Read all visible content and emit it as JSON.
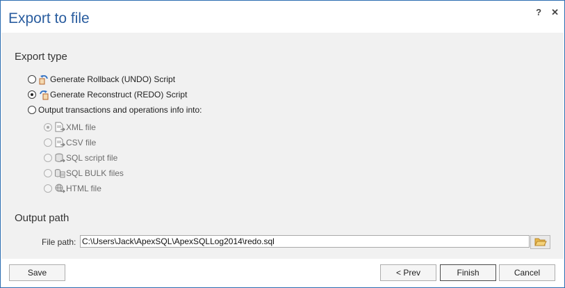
{
  "dialog": {
    "title": "Export to file",
    "help_glyph": "?",
    "close_glyph": "✕"
  },
  "export_type": {
    "heading": "Export type",
    "options": [
      {
        "label": "Generate Rollback (UNDO) Script",
        "icon": "undo-script-icon",
        "checked": false
      },
      {
        "label": "Generate Reconstruct (REDO) Script",
        "icon": "redo-script-icon",
        "checked": true
      },
      {
        "label": "Output transactions and operations info into:",
        "icon": null,
        "checked": false
      }
    ],
    "sub_options": [
      {
        "label": "XML file",
        "icon": "xml-file-icon",
        "checked": true,
        "enabled": false
      },
      {
        "label": "CSV file",
        "icon": "csv-file-icon",
        "checked": false,
        "enabled": false
      },
      {
        "label": "SQL script file",
        "icon": "sql-script-file-icon",
        "checked": false,
        "enabled": false
      },
      {
        "label": "SQL BULK files",
        "icon": "sql-bulk-files-icon",
        "checked": false,
        "enabled": false
      },
      {
        "label": "HTML file",
        "icon": "html-file-icon",
        "checked": false,
        "enabled": false
      }
    ]
  },
  "output_path": {
    "heading": "Output path",
    "label": "File path:",
    "value": "C:\\Users\\Jack\\ApexSQL\\ApexSQLLog2014\\redo.sql",
    "browse_icon": "folder-open-icon"
  },
  "footer": {
    "save": "Save",
    "prev": "< Prev",
    "finish": "Finish",
    "cancel": "Cancel"
  },
  "colors": {
    "title": "#2a5d9f",
    "border": "#2b6cb0",
    "content_bg": "#f1f1f1"
  }
}
